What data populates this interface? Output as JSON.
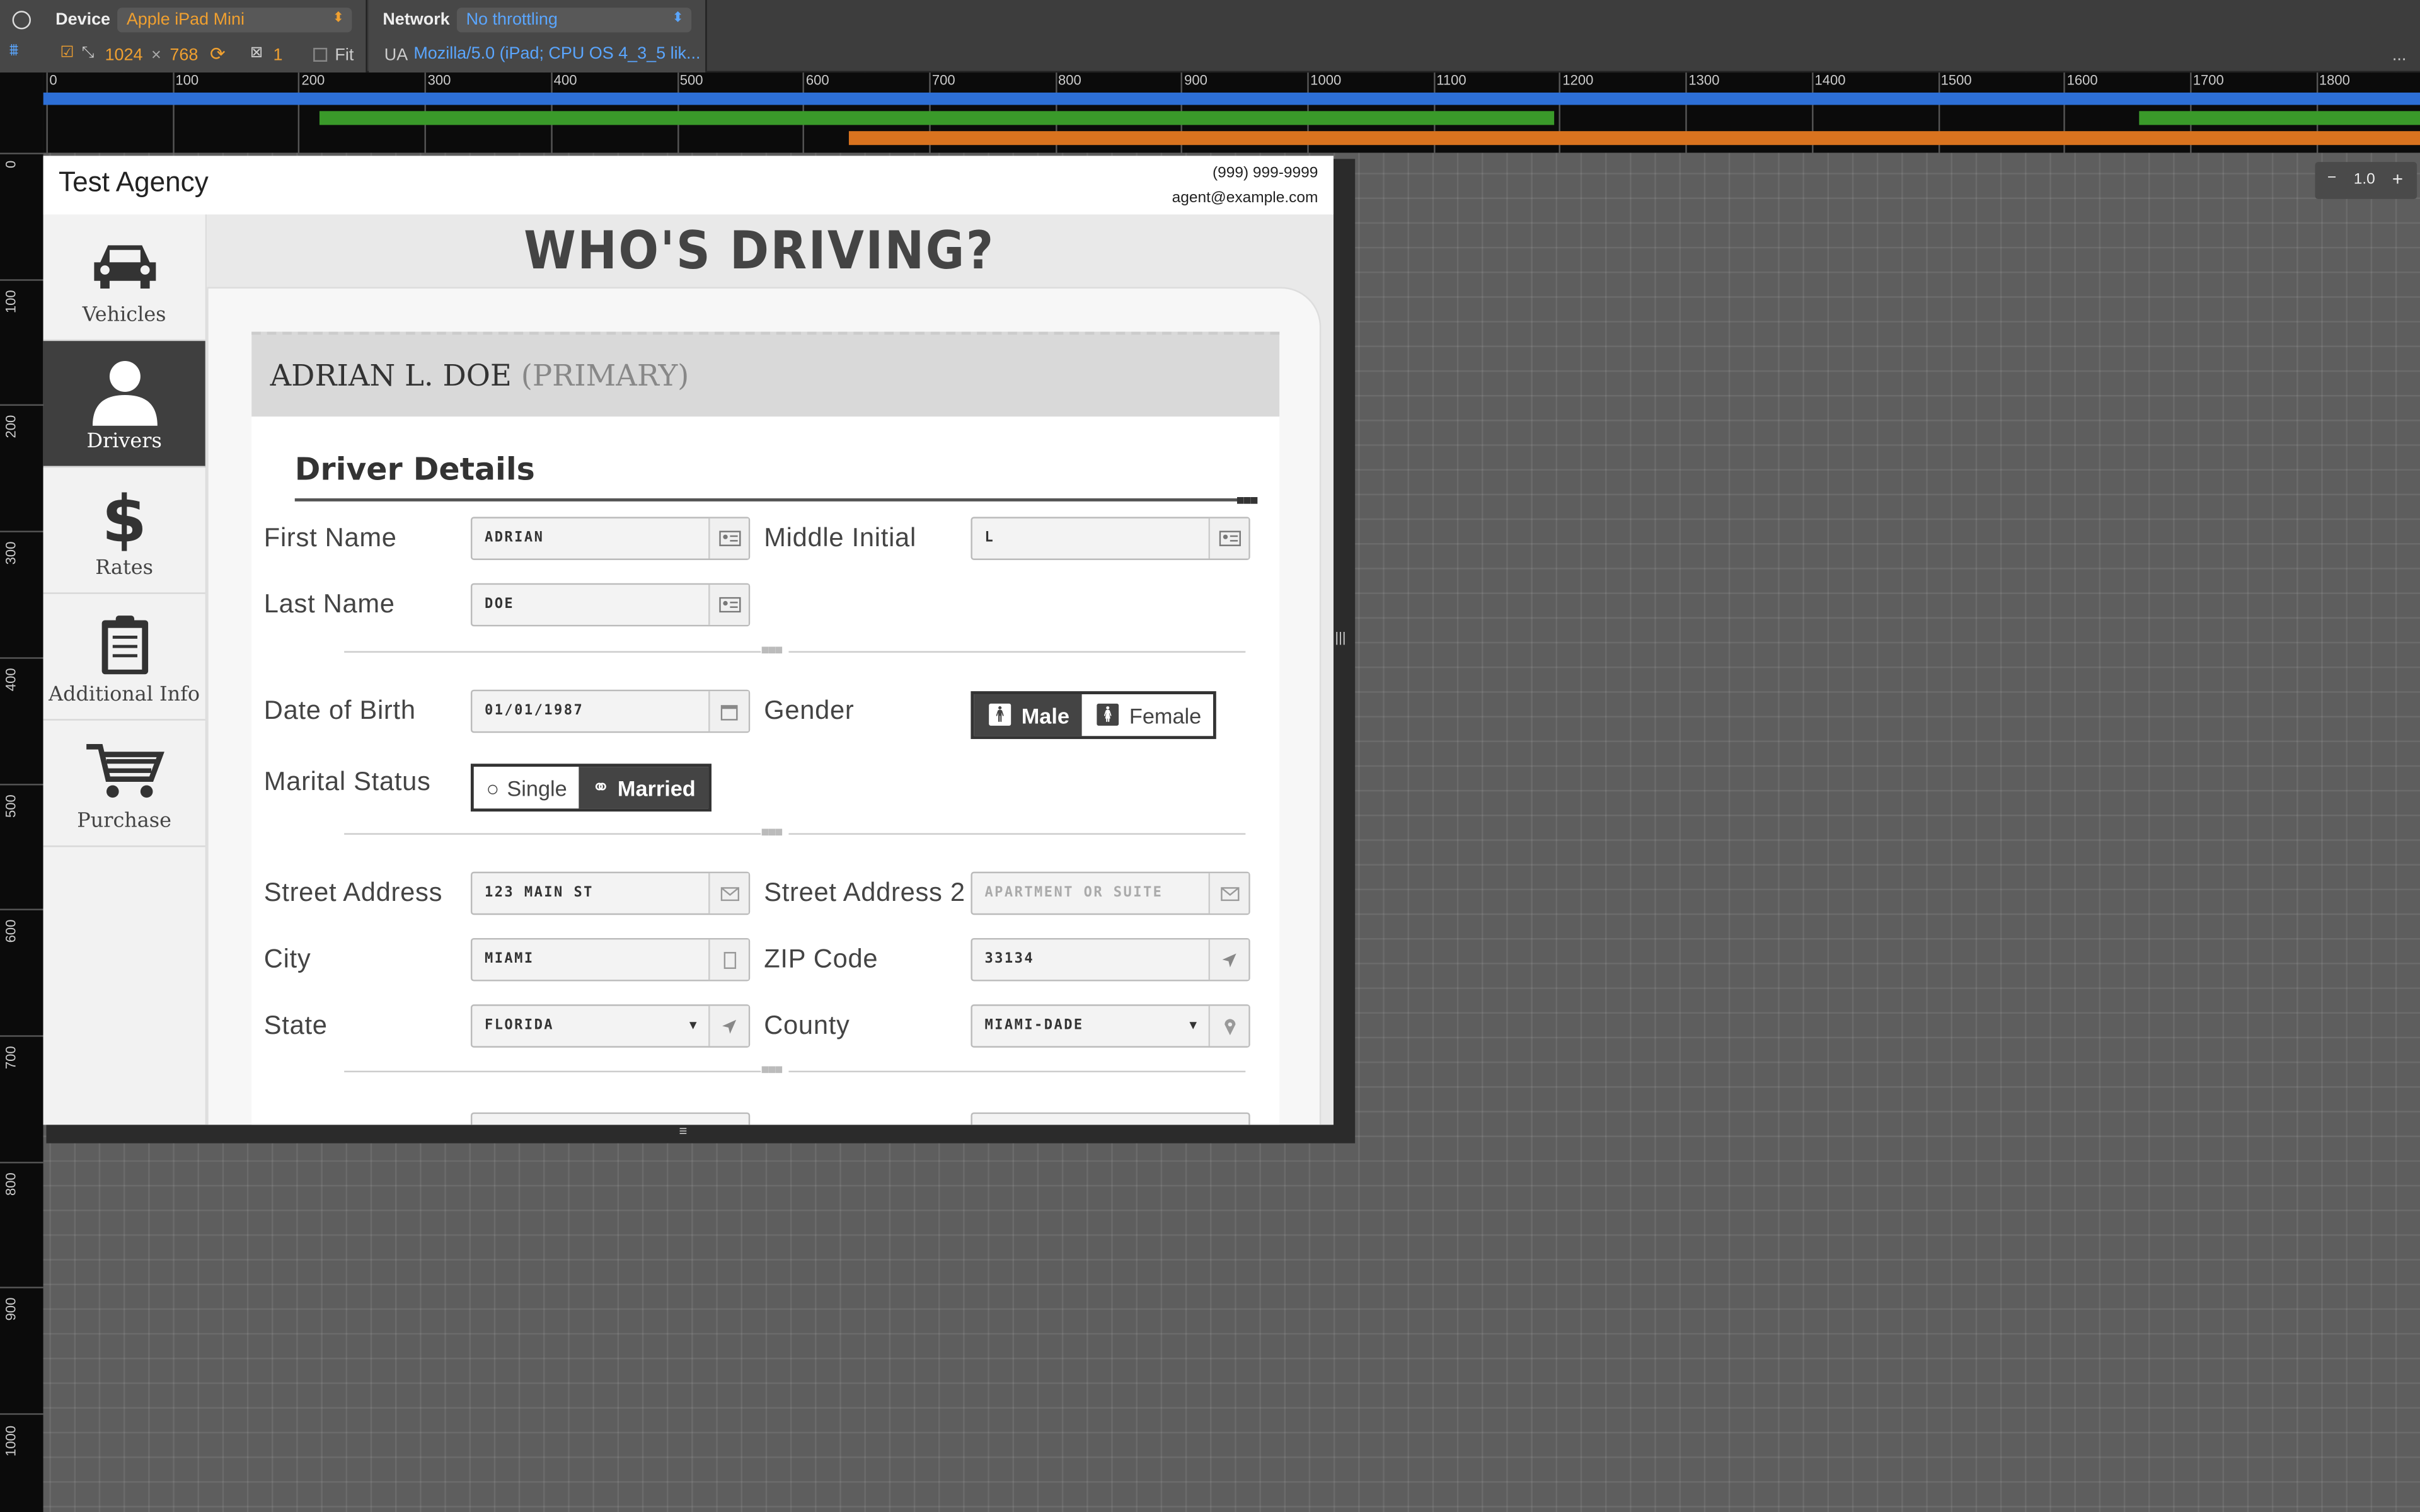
{
  "toolbar": {
    "device_label": "Device",
    "device_value": "Apple iPad Mini",
    "network_label": "Network",
    "network_value": "No throttling",
    "width": "1024",
    "x": "×",
    "height": "768",
    "scale": "1",
    "fit_label": "Fit",
    "ua_label": "UA",
    "ua_value": "Mozilla/5.0 (iPad; CPU OS 4_3_5 lik...",
    "more": "..."
  },
  "ruler": {
    "h_labels": [
      "0",
      "100",
      "200",
      "300",
      "400",
      "500",
      "600",
      "700",
      "800",
      "900",
      "1000",
      "1100",
      "1200",
      "1300",
      "1400",
      "1500",
      "1600",
      "1700",
      "1800"
    ],
    "v_labels": [
      "0",
      "100",
      "200",
      "300",
      "400",
      "500",
      "600",
      "700",
      "800",
      "900",
      "1000"
    ]
  },
  "zoom": {
    "value": "1.0",
    "minus": "−",
    "plus": "+"
  },
  "app": {
    "agency": "Test Agency",
    "phone": "(999) 999-9999",
    "email": "agent@example.com",
    "nav": [
      {
        "label": "Vehicles",
        "icon": "car-icon"
      },
      {
        "label": "Drivers",
        "icon": "person-icon"
      },
      {
        "label": "Rates",
        "icon": "dollar-icon"
      },
      {
        "label": "Additional Info",
        "icon": "clipboard-icon"
      },
      {
        "label": "Purchase",
        "icon": "cart-icon"
      }
    ],
    "page_title": "WHO'S DRIVING?",
    "driver_name": "ADRIAN L. DOE",
    "driver_role": "(PRIMARY)",
    "section_title": "Driver Details",
    "fields": {
      "first_name": {
        "label": "First Name",
        "value": "ADRIAN"
      },
      "middle_initial": {
        "label": "Middle Initial",
        "value": "L"
      },
      "last_name": {
        "label": "Last Name",
        "value": "DOE"
      },
      "dob": {
        "label": "Date of Birth",
        "value": "01/01/1987"
      },
      "gender": {
        "label": "Gender",
        "options": [
          "Male",
          "Female"
        ],
        "selected": "Male"
      },
      "marital": {
        "label": "Marital Status",
        "options": [
          "Single",
          "Married"
        ],
        "selected": "Married"
      },
      "street": {
        "label": "Street Address",
        "value": "123 MAIN ST"
      },
      "street2": {
        "label": "Street Address 2",
        "placeholder": "APARTMENT OR SUITE"
      },
      "city": {
        "label": "City",
        "value": "MIAMI"
      },
      "zip": {
        "label": "ZIP Code",
        "value": "33134"
      },
      "state": {
        "label": "State",
        "value": "FLORIDA"
      },
      "county": {
        "label": "County",
        "value": "MIAMI-DADE"
      }
    }
  }
}
